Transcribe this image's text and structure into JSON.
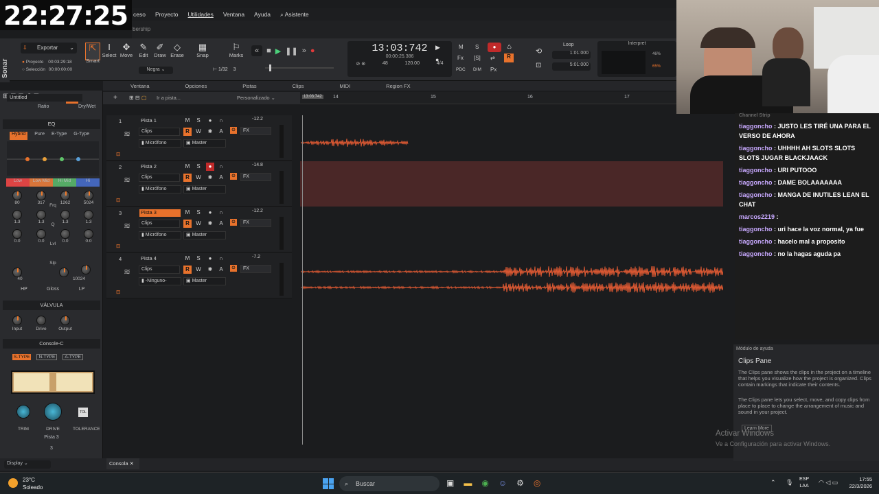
{
  "overlay": {
    "clock": "22:27:25"
  },
  "menu": [
    "ceso",
    "Proyecto",
    "Utilidades",
    "Ventana",
    "Ayuda",
    "⌕ Asistente"
  ],
  "tab_label": "bership",
  "app": {
    "name": "Sonar"
  },
  "control": {
    "export": "Exportar",
    "project_label": "Proyecto",
    "project_time": "00:03:29:18",
    "selection_label": "Selección",
    "selection_time": "00:00:00:00",
    "tools": [
      "Smart",
      "Select",
      "Move",
      "Edit",
      "Draw",
      "Erase"
    ],
    "snap": "Snap",
    "snap_value": "1/32",
    "snap_num": "3",
    "marks": "Marks",
    "color": "Negra",
    "time": "13:03:742",
    "subtime": "00:00:25.386",
    "tempo": "120.00",
    "sig": "4/4",
    "t1": "48",
    "t2": "16",
    "loop": "Loop",
    "loop_start": "1:01:000",
    "loop_end": "5:01:000",
    "interpret": "Interpret",
    "p1": "46%",
    "p2": "65%",
    "pdc": "PDC",
    "dim": "DIM",
    "px": "Px"
  },
  "viewbar": [
    "Ventana",
    "Opciones",
    "Pistas",
    "Clips",
    "MIDI",
    "Region FX"
  ],
  "trackbar": {
    "goto": "Ir a pista...",
    "preset": "Personalizado"
  },
  "ruler": {
    "marks": [
      "14",
      "15",
      "16",
      "17"
    ],
    "pos": "13:03:742"
  },
  "left": {
    "title": "Untitled",
    "ratio": "Ratio",
    "drywet": "Dry/Wet",
    "eq": {
      "title": "EQ",
      "modes": [
        "Hybrid",
        "Pure",
        "E-Type",
        "G-Type"
      ],
      "bands": [
        "Low",
        "Low Mid",
        "Hi Mid",
        "Hi"
      ],
      "rows": [
        [
          "80",
          "317",
          "1262",
          "5024"
        ],
        [
          "1.3",
          "1.3",
          "1.3",
          "1.3"
        ],
        [
          "0.0",
          "0.0",
          "0.0",
          "0.0"
        ]
      ],
      "labels": [
        "Frq",
        "Q",
        "Lvl"
      ],
      "slp": "Slp",
      "lo": "40",
      "hi": "10024",
      "filters": [
        "HP",
        "Gloss",
        "LP"
      ]
    },
    "valve": {
      "title": "VÁLVULA",
      "knobs": [
        "Input",
        "Drive",
        "Output"
      ]
    },
    "console": {
      "title": "Console-C",
      "types": [
        "S-TYPE",
        "N-TYPE",
        "A-TYPE"
      ],
      "knobs": [
        "TRIM",
        "DRIVE",
        "TOLERANCE"
      ],
      "tol": "TOL",
      "track": "Pista 3",
      "num": "3"
    },
    "display": "Display"
  },
  "tracks": [
    {
      "num": "1",
      "name": "Pista 1",
      "clip": "Clips",
      "input": "Micrófono",
      "output": "Master",
      "vol": "-12.2"
    },
    {
      "num": "2",
      "name": "Pista 2",
      "clip": "Clips",
      "input": "Micrófono",
      "output": "Master",
      "vol": "-14.8"
    },
    {
      "num": "3",
      "name": "Pista 3",
      "clip": "Clips",
      "input": "Micrófono",
      "output": "Master",
      "vol": "-12.2"
    },
    {
      "num": "4",
      "name": "Pista 4",
      "clip": "Clips",
      "input": "-Ninguno-",
      "output": "Master",
      "vol": "-7.2"
    }
  ],
  "track_buttons": [
    "M",
    "S",
    "●",
    "R",
    "W",
    "FX"
  ],
  "chat": [
    {
      "u": "",
      "t": "Channel Strip"
    },
    {
      "u": "tiaggoncho",
      "t": " : JUSTO LES TIRÉ UNA PARA EL VERSO DE AHORA"
    },
    {
      "u": "tiaggoncho",
      "t": " : UHHHH AH SLOTS SLOTS SLOTS JUGAR BLACKJAACK"
    },
    {
      "u": "tiaggoncho",
      "t": " : URI PUTOOO"
    },
    {
      "u": "tiaggoncho",
      "t": " : DAME BOLAAAAAAA"
    },
    {
      "u": "tiaggoncho",
      "t": " : MANGA DE INUTILES LEAN EL CHAT"
    },
    {
      "u": "marcos2219",
      "t": " : "
    },
    {
      "u": "tiaggoncho",
      "t": " : uri hace la voz normal, ya fue"
    },
    {
      "u": "tiaggoncho",
      "t": " : hacelo mal a proposito"
    },
    {
      "u": "tiaggoncho",
      "t": " : no la hagas aguda pa"
    }
  ],
  "help": {
    "header": "Módulo de ayuda",
    "title": "Clips Pane",
    "p1": "The Clips pane shows the clips in the project on a timeline that helps you visualize how the project is organized. Clips contain markings that indicate their contents.",
    "p2": "The Clips pane lets you select, move, and copy clips from place to place to change the arrangement of music and sound in your project.",
    "learn": "Learn More"
  },
  "activate": {
    "t1": "Activar Windows",
    "t2": "Ve a Configuración para activar Windows."
  },
  "console_tab": "Consola",
  "taskbar": {
    "temp": "23°C",
    "weather": "Soleado",
    "search": "Buscar",
    "lang1": "ESP",
    "lang2": "LAA",
    "time": "17:55",
    "date": "22/3/2026"
  },
  "colors": {
    "accent": "#e8722c",
    "bg": "#1b1c1e",
    "waveform": "#e05a33"
  }
}
